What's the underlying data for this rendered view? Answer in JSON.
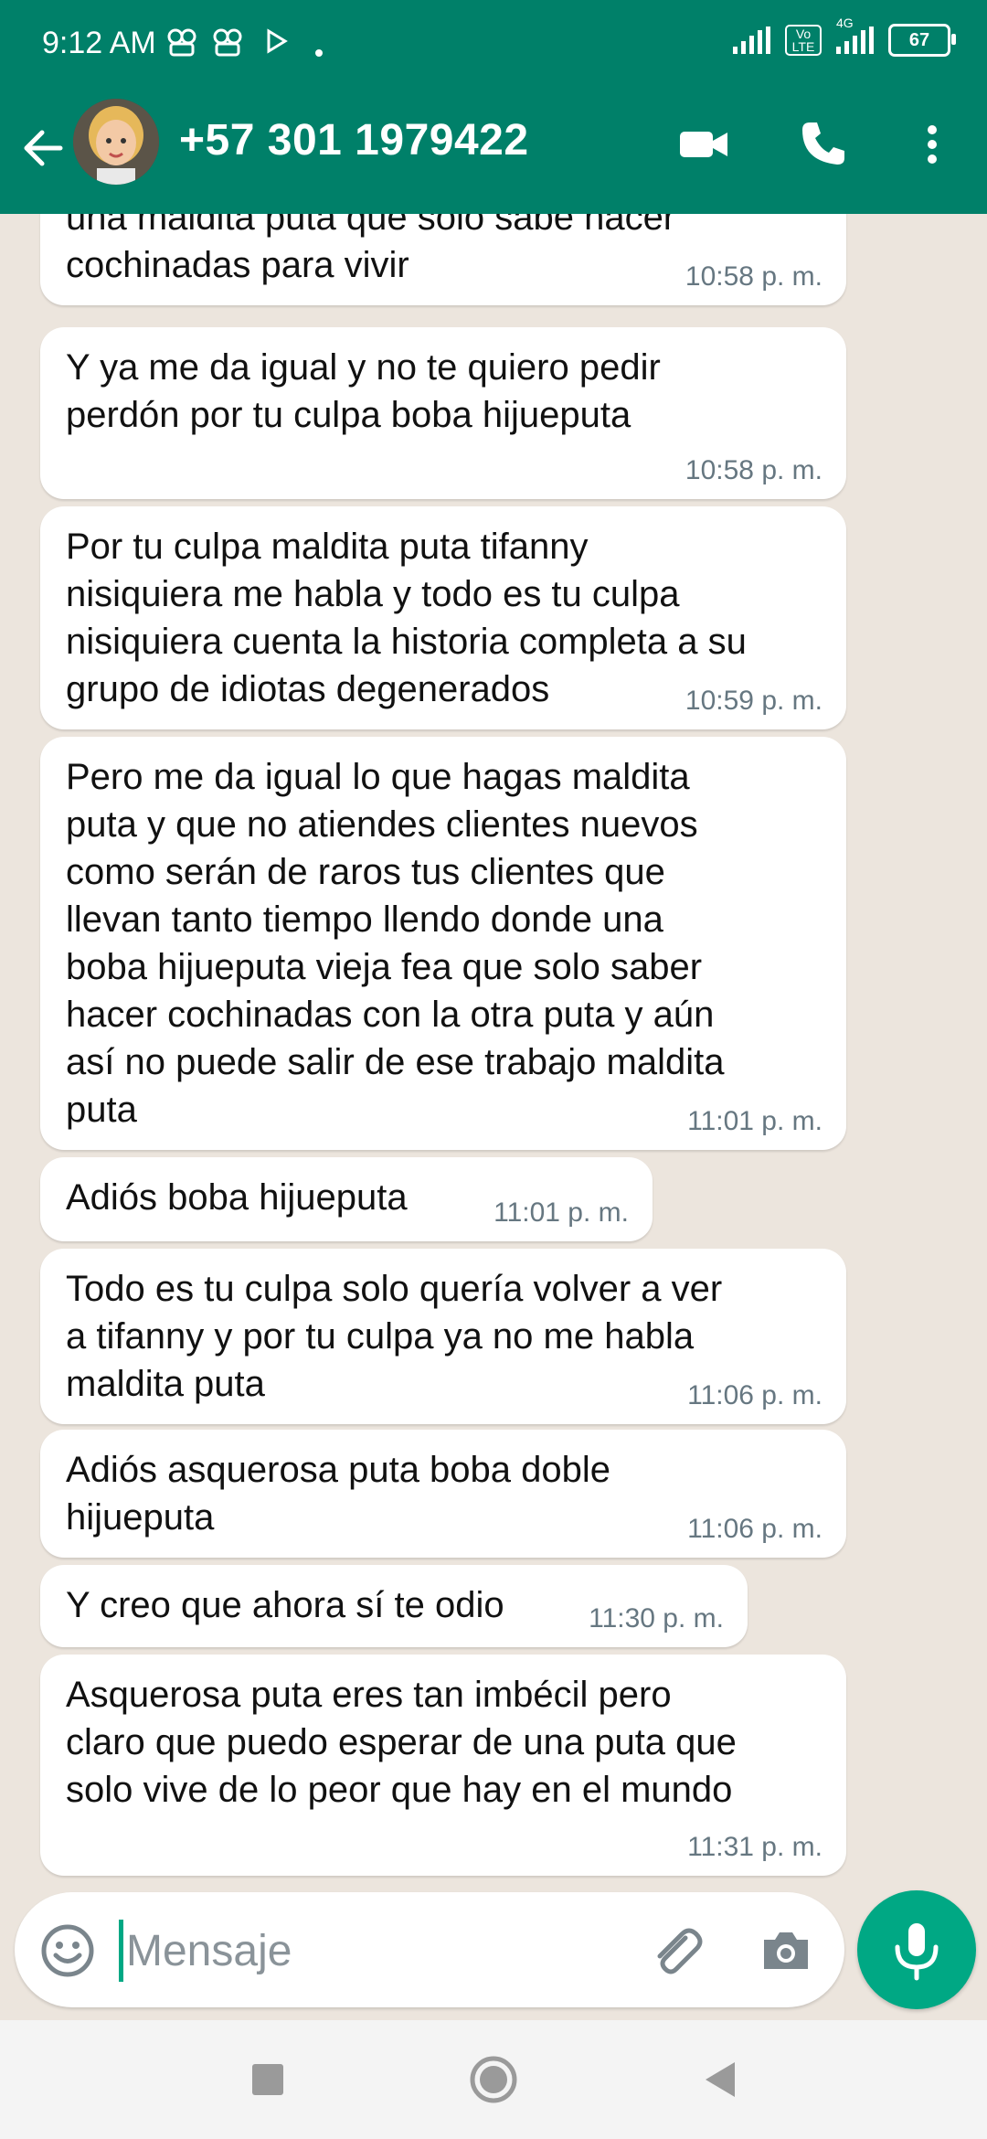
{
  "status_bar": {
    "time": "9:12 AM",
    "network": "4G",
    "volte": "Vo LTE",
    "battery": "67"
  },
  "header": {
    "contact_name": "+57 301 1979422"
  },
  "messages": [
    {
      "text": "una maldita puta que solo sabe hacer\ncochinadas para vivir",
      "time": "10:58 p. m."
    },
    {
      "text": "Y ya me da igual y no te quiero pedir\nperdón por tu culpa boba hijueputa",
      "time": "10:58 p. m."
    },
    {
      "text": "Por tu culpa maldita puta tifanny\nnisiquiera me habla y todo es tu culpa\nnisiquiera cuenta la historia completa a su\ngrupo de idiotas degenerados",
      "time": "10:59 p. m."
    },
    {
      "text": "Pero me da igual lo que hagas maldita\nputa y que no atiendes clientes nuevos\ncomo serán de raros tus clientes que\nllevan tanto tiempo llendo donde una\nboba hijueputa vieja fea que solo saber\nhacer cochinadas con la otra puta y aún\nasí no puede salir de ese trabajo maldita\nputa",
      "time": "11:01 p. m."
    },
    {
      "text": "Adiós boba hijueputa",
      "time": "11:01 p. m."
    },
    {
      "text": "Todo es tu culpa solo quería volver a ver\na tifanny y por tu culpa ya no me habla\nmaldita puta",
      "time": "11:06 p. m."
    },
    {
      "text": "Adiós asquerosa puta boba doble\nhijueputa",
      "time": "11:06 p. m."
    },
    {
      "text": "Y creo que ahora sí te odio",
      "time": "11:30 p. m."
    },
    {
      "text": "Asquerosa puta eres tan imbécil pero\nclaro que puedo esperar de una puta que\nsolo vive de lo peor que hay en el mundo",
      "time": "11:31 p. m."
    }
  ],
  "composer": {
    "placeholder": "Mensaje"
  },
  "colors": {
    "header": "#008069",
    "accent": "#00a884",
    "chat_background": "#ece5dd",
    "timestamp": "#667781"
  }
}
